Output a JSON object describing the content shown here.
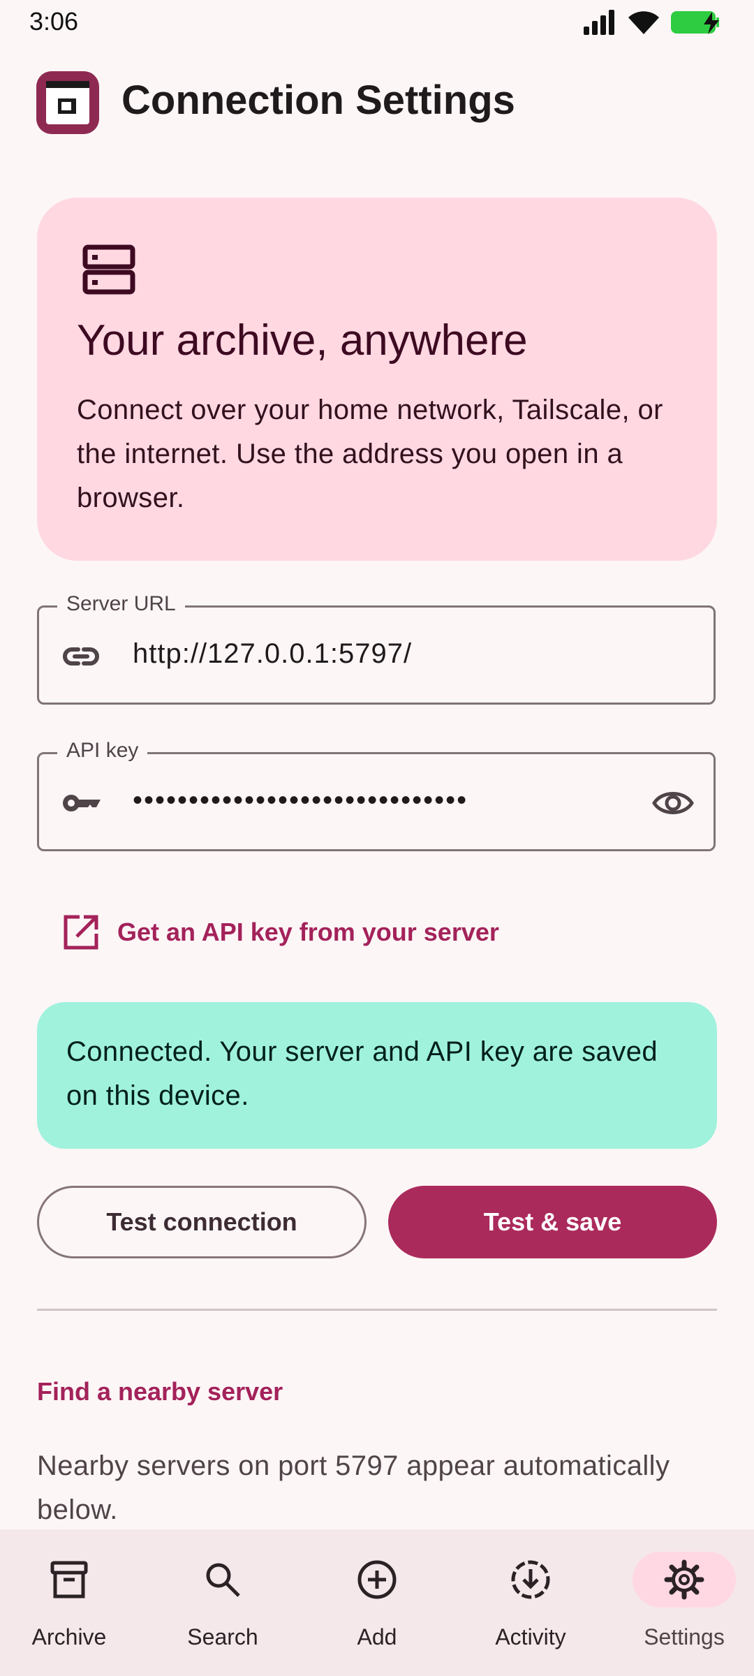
{
  "status_bar": {
    "time": "3:06"
  },
  "app_bar": {
    "title": "Connection Settings"
  },
  "hero": {
    "icon": "server-icon",
    "title": "Your archive, anywhere",
    "body": "Connect over your home network, Tailscale, or the internet. Use the address you open in a browser."
  },
  "server_url": {
    "label": "Server URL",
    "value": "http://127.0.0.1:5797/",
    "icon": "link-icon"
  },
  "api_key": {
    "label": "API key",
    "value": "••••••••••••••••••••••••••••••",
    "icon": "key-icon",
    "toggle_icon": "eye-icon"
  },
  "api_link": {
    "label": "Get an API key from your server",
    "icon": "open-external-icon"
  },
  "status_message": "Connected. Your server and API key are saved on this device.",
  "buttons": {
    "test": "Test connection",
    "save": "Test & save"
  },
  "nearby": {
    "title": "Find a nearby server",
    "body": "Nearby servers on port 5797 appear automatically below."
  },
  "bottom_nav": [
    {
      "label": "Archive",
      "icon": "archive-icon",
      "active": false
    },
    {
      "label": "Search",
      "icon": "search-icon",
      "active": false
    },
    {
      "label": "Add",
      "icon": "add-circle-icon",
      "active": false
    },
    {
      "label": "Activity",
      "icon": "download-activity-icon",
      "active": false
    },
    {
      "label": "Settings",
      "icon": "gear-icon",
      "active": true
    }
  ],
  "colors": {
    "accent": "#ab2a5c",
    "hero_bg": "#ffd8e2",
    "success_bg": "#a0f2dd",
    "nav_bg": "#f4e8ea"
  }
}
